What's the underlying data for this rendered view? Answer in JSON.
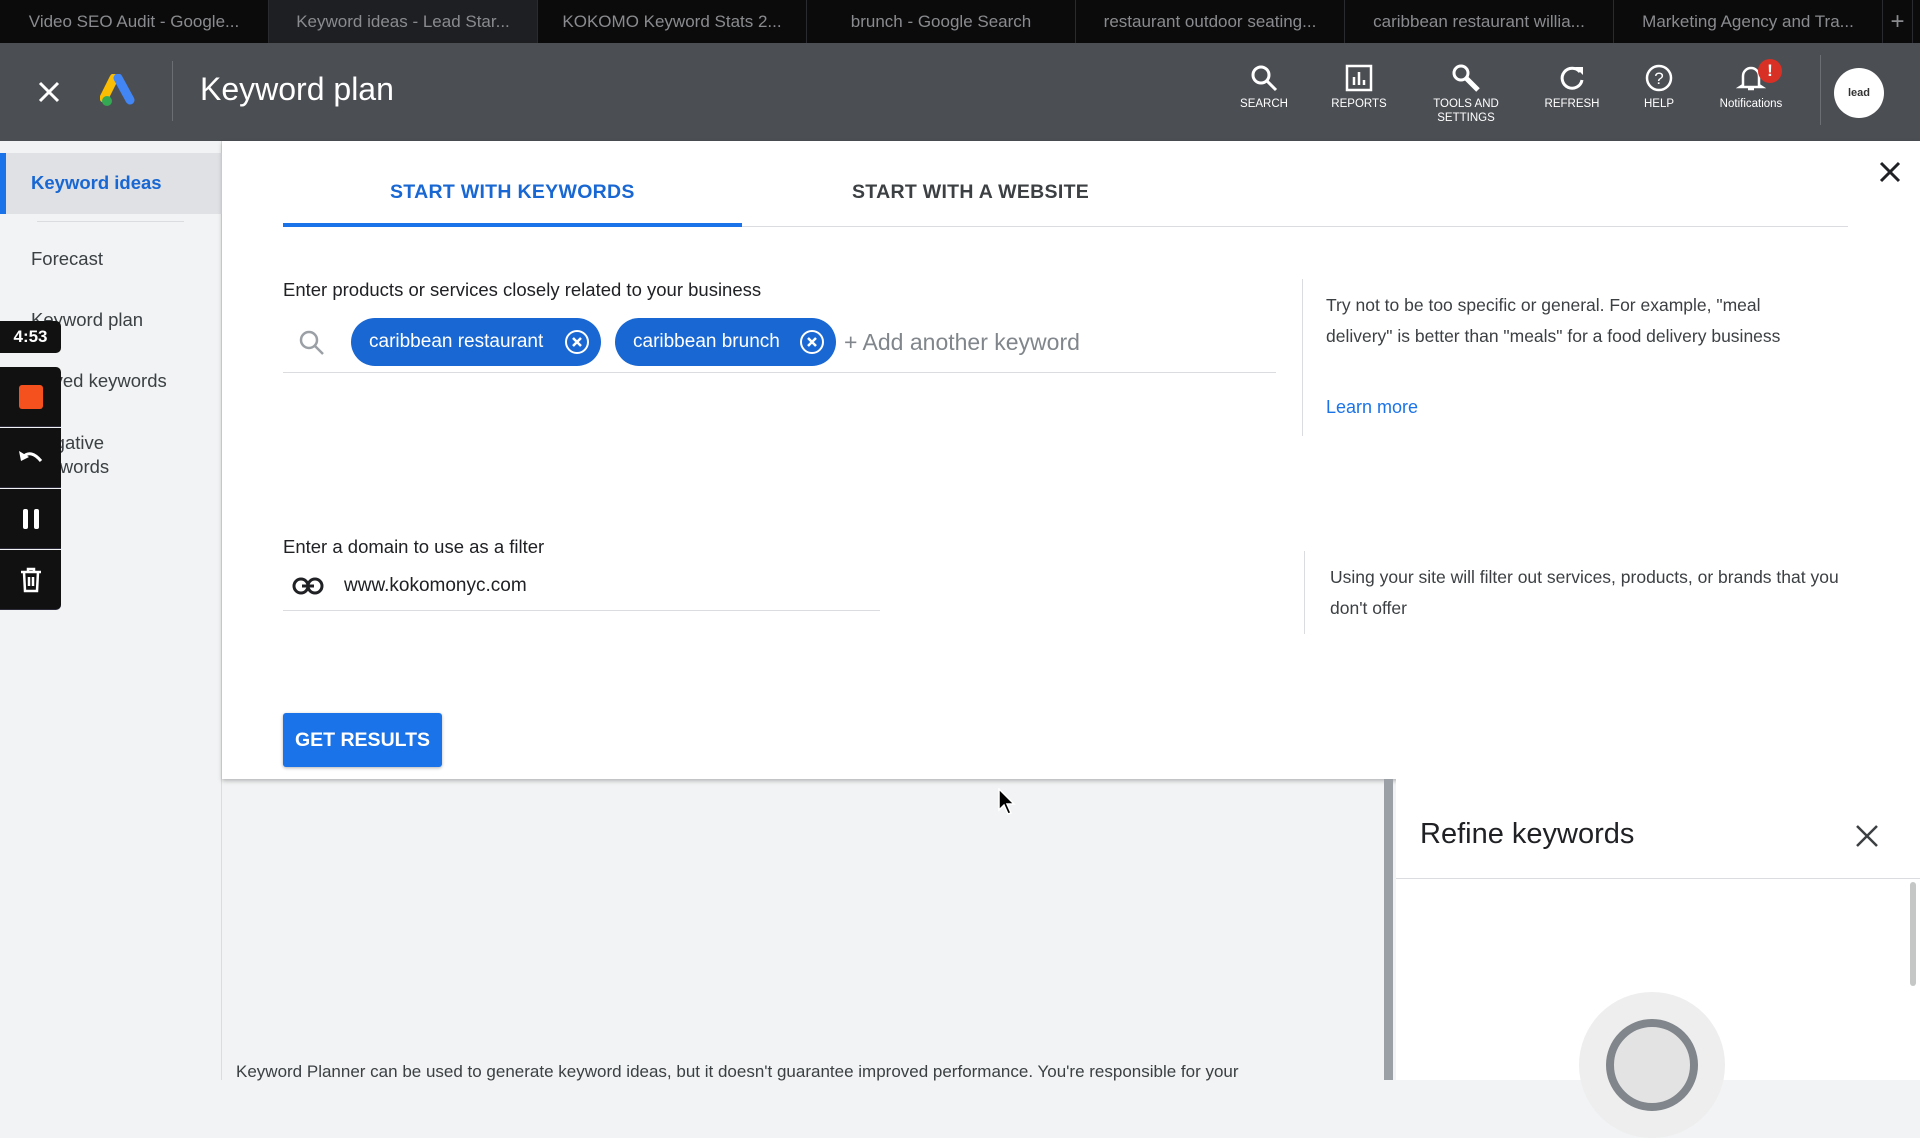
{
  "browser_tabs": [
    {
      "label": "Video SEO Audit - Google..."
    },
    {
      "label": "Keyword ideas - Lead Star...",
      "active": true
    },
    {
      "label": "KOKOMO Keyword Stats 2..."
    },
    {
      "label": "brunch - Google Search"
    },
    {
      "label": "restaurant outdoor seating..."
    },
    {
      "label": "caribbean restaurant willia..."
    },
    {
      "label": "Marketing Agency and Tra..."
    }
  ],
  "new_tab": "+",
  "header": {
    "title": "Keyword plan",
    "actions": [
      {
        "label": "SEARCH",
        "icon": "search-icon"
      },
      {
        "label": "REPORTS",
        "icon": "reports-icon"
      },
      {
        "label": "TOOLS AND SETTINGS",
        "icon": "wrench-icon"
      },
      {
        "label": "REFRESH",
        "icon": "refresh-icon"
      },
      {
        "label": "HELP",
        "icon": "help-icon"
      },
      {
        "label": "Notifications",
        "icon": "bell-icon",
        "badge": "!"
      }
    ],
    "avatar_text": "lead"
  },
  "sidebar": {
    "items": [
      {
        "label": "Keyword ideas",
        "active": true
      },
      {
        "label": "Forecast"
      },
      {
        "label": "Keyword plan"
      },
      {
        "label": "Saved keywords"
      },
      {
        "label": "Negative keywords"
      }
    ],
    "visible_fragments": [
      "Keyword ideas",
      "Forecast",
      "Keyword plan",
      "ed keywords",
      "gative",
      "words"
    ]
  },
  "recorder": {
    "time": "4:53"
  },
  "main": {
    "tabs": [
      {
        "label": "START WITH KEYWORDS",
        "active": true
      },
      {
        "label": "START WITH A WEBSITE"
      }
    ],
    "keywords_label": "Enter products or services closely related to your business",
    "chips": [
      "caribbean restaurant",
      "caribbean brunch"
    ],
    "add_keyword_placeholder": "+ Add another keyword",
    "keywords_help": "Try not to be too specific or general. For example, \"meal delivery\" is better than \"meals\" for a food delivery business",
    "learn_more": "Learn more",
    "domain_label": "Enter a domain to use as a filter",
    "domain_value": "www.kokomonyc.com",
    "domain_help": "Using your site will filter out services, products, or brands that you don't offer",
    "get_results": "GET RESULTS"
  },
  "refine": {
    "title": "Refine keywords"
  },
  "footer_text": "Keyword Planner can be used to generate keyword ideas, but it doesn't guarantee improved performance. You're responsible for your",
  "colors": {
    "accent": "#1a73e8",
    "chip": "#1967d2",
    "header": "#4b4e53",
    "badge": "#d93025",
    "record": "#f4511e"
  }
}
